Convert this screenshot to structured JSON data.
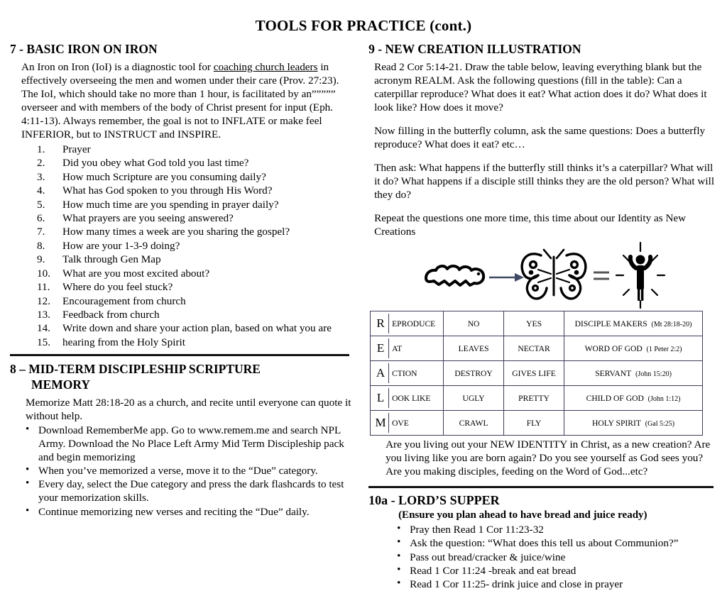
{
  "document": {
    "title": "TOOLS FOR PRACTICE (cont.)"
  },
  "left_column": {
    "section7": {
      "heading": "7 - BASIC IRON ON IRON",
      "paragraph_part1": "An Iron on Iron (IoI) is a diagnostic tool for ",
      "paragraph_underlined": "coaching church leaders",
      "paragraph_part2": " in effectively overseeing the men and women under their care (Prov. 27:23). The IoI, which should take no more than 1 hour, is facilitated by an””””” overseer and with members of the body of Christ present for input (Eph. 4:11-13). Always remember, the goal is not to INFLATE or make feel INFERIOR, but to INSTRUCT and INSPIRE.",
      "items": [
        "Prayer",
        "Did you obey what God told you last time?",
        "How much Scripture are you consuming daily?",
        "What has God spoken to you through His Word?",
        "How much time are you spending in prayer daily?",
        "What prayers are you seeing answered?",
        "How many times a week are you sharing the gospel?",
        "How are your 1-3-9 doing?",
        "Talk through Gen Map",
        "What are you most excited about?",
        "Where do you feel stuck?",
        "Encouragement from church",
        "Feedback from church",
        "Write down and share your action plan, based on what you are",
        "hearing from the Holy Spirit"
      ]
    },
    "section8": {
      "heading_line1": "8 – MID-TERM DISCIPLESHIP SCRIPTURE",
      "heading_line2": "MEMORY",
      "intro": "Memorize Matt 28:18-20 as a church, and recite until everyone can quote it without help.",
      "bullets": [
        "Download RememberMe app. Go to www.remem.me and search NPL Army. Download the No Place Left Army Mid Term Discipleship pack and begin memorizing",
        "When you’ve memorized a verse, move it to the “Due” category.",
        "Every day, select the Due category and press the dark flashcards to test your memorization skills.",
        "Continue memorizing new verses and reciting the “Due” daily."
      ]
    }
  },
  "right_column": {
    "section9": {
      "heading": "9 - NEW CREATION ILLUSTRATION",
      "paragraphs": [
        "Read 2 Cor 5:14-21. Draw the table below, leaving everything blank but the acronym REALM. Ask the following questions (fill in the table): Can a caterpillar reproduce? What does it eat? What action does it do? What does it look like? How does it move?",
        "Now filling in the butterfly column, ask the same questions: Does a butterfly reproduce? What does it eat? etc…",
        "Then ask: What happens if the butterfly still thinks it’s a caterpillar? What will it do? What happens if a disciple still thinks they are the old person? What will they do?",
        "Repeat the questions one more time, this time about our Identity as New Creations"
      ],
      "illustration": {
        "caterpillar_icon": "caterpillar-icon",
        "arrow_icon": "arrow-right-icon",
        "butterfly_icon": "butterfly-icon",
        "equals_icon": "equals-sign-icon",
        "person_icon": "radiant-person-icon"
      },
      "table": {
        "rows": [
          {
            "letter": "R",
            "rest": "EPRODUCE",
            "caterpillar": "NO",
            "butterfly": "YES",
            "identity": "DISCIPLE MAKERS",
            "reference": "(Mt 28:18-20)"
          },
          {
            "letter": "E",
            "rest": "AT",
            "caterpillar": "LEAVES",
            "butterfly": "NECTAR",
            "identity": "WORD OF GOD",
            "reference": "(1 Peter 2:2)"
          },
          {
            "letter": "A",
            "rest": "CTION",
            "caterpillar": "DESTROY",
            "butterfly": "GIVES LIFE",
            "identity": "SERVANT",
            "reference": "(John 15:20)"
          },
          {
            "letter": "L",
            "rest": "OOK LIKE",
            "caterpillar": "UGLY",
            "butterfly": "PRETTY",
            "identity": "CHILD OF GOD",
            "reference": "(John 1:12)"
          },
          {
            "letter": "M",
            "rest": "OVE",
            "caterpillar": "CRAWL",
            "butterfly": "FLY",
            "identity": "HOLY SPIRIT",
            "reference": "(Gal 5:25)"
          }
        ]
      },
      "closing_text": "Are you living out your NEW IDENTITY in Christ, as a new creation? Are you living like you are born again? Do you see yourself as God sees you? Are you making disciples, feeding on the Word of God...etc?"
    },
    "section10a": {
      "heading": "10a -  LORD’S SUPPER",
      "subheading": "(Ensure you plan ahead to have bread and juice ready)",
      "bullets": [
        "Pray then Read 1 Cor 11:23-32",
        "Ask the question: “What does this tell us about Communion?”",
        "Pass out bread/cracker & juice/wine",
        "Read 1 Cor 11:24 -break and eat bread",
        "Read 1 Cor 11:25- drink juice and close in prayer"
      ]
    }
  }
}
